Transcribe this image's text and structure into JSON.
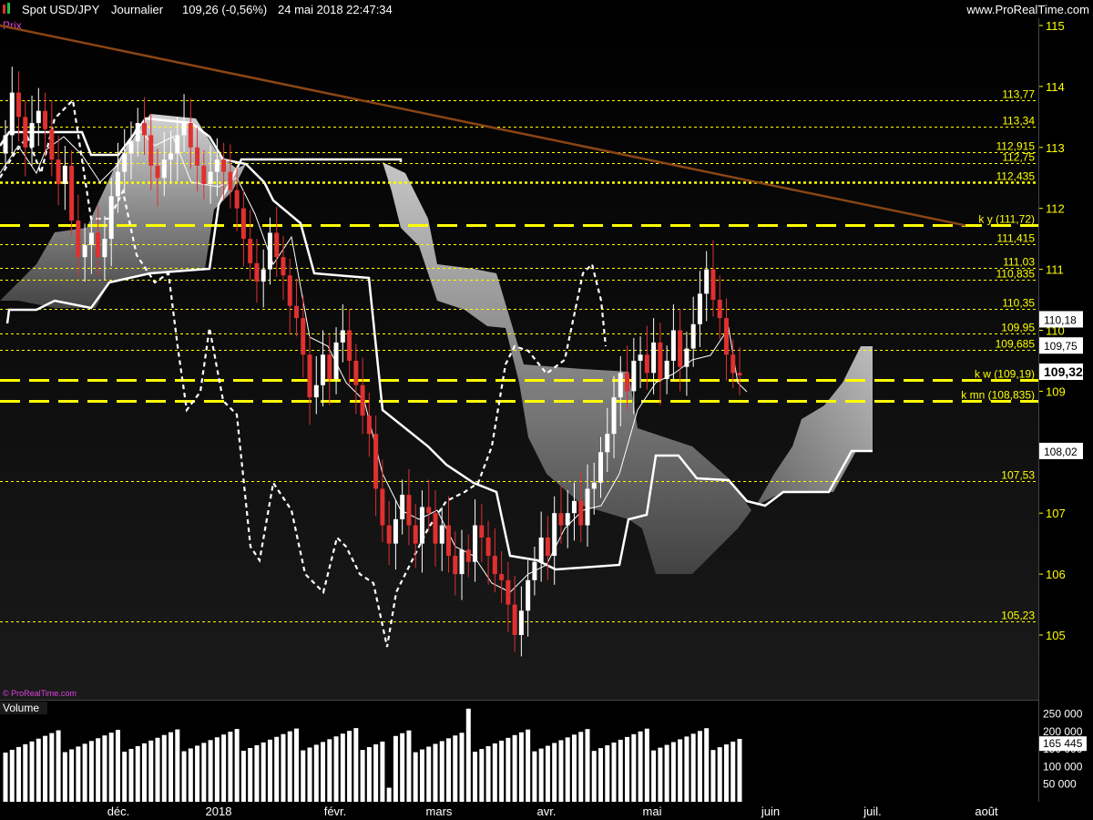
{
  "header": {
    "title": "Spot USD/JPY",
    "period": "Journalier",
    "last": "109,26 (-0,56%)",
    "datetime": "24 mai 2018 22:47:34",
    "site": "www.ProRealTime.com"
  },
  "price_panel_label": "Prix",
  "volume_panel_label": "Volume",
  "watermark": "© ProRealTime.com",
  "colors": {
    "background": "#000000",
    "axis_text": "#ffff00",
    "up_candle": "#ffffff",
    "down_candle": "#e03030",
    "level_line": "#ffff00",
    "trendline": "#8b4513",
    "cloud": "#9a9a9a"
  },
  "chart_data": {
    "type": "candlestick",
    "y_axis": {
      "ticks": [
        105,
        106,
        107,
        108,
        109,
        110,
        111,
        112,
        113,
        114,
        115
      ]
    },
    "x_axis": {
      "ticks": [
        "déc.",
        "2018",
        "févr.",
        "mars",
        "avr.",
        "mai",
        "juin",
        "juil.",
        "août"
      ]
    },
    "price_labels": [
      {
        "label": "110,18",
        "value": 110.18
      },
      {
        "label": "109,75",
        "value": 109.75
      },
      {
        "label": "109,32",
        "value": 109.32
      },
      {
        "label": "108,02",
        "value": 108.02
      }
    ],
    "levels": [
      {
        "label": "113,77",
        "value": 113.77,
        "style": "dotted"
      },
      {
        "label": "113,34",
        "value": 113.34,
        "style": "dotted"
      },
      {
        "label": "112,915",
        "value": 112.915,
        "style": "dotted"
      },
      {
        "label": "112,75",
        "value": 112.75,
        "style": "dotted"
      },
      {
        "label": "112,435",
        "value": 112.435,
        "style": "thick-dotted"
      },
      {
        "label": "k y (111,72)",
        "value": 111.72,
        "style": "dashed"
      },
      {
        "label": "111,415",
        "value": 111.415,
        "style": "dotted"
      },
      {
        "label": "111,03",
        "value": 111.03,
        "style": "dotted"
      },
      {
        "label": "110,835",
        "value": 110.835,
        "style": "dotted"
      },
      {
        "label": "110,35",
        "value": 110.35,
        "style": "dotted"
      },
      {
        "label": "109,95",
        "value": 109.95,
        "style": "dotted"
      },
      {
        "label": "109,685",
        "value": 109.685,
        "style": "dotted"
      },
      {
        "label": "k w (109,19)",
        "value": 109.19,
        "style": "dashed"
      },
      {
        "label": "k mn (108,835)",
        "value": 108.835,
        "style": "dashed"
      },
      {
        "label": "107,53",
        "value": 107.53,
        "style": "dotted"
      },
      {
        "label": "105,23",
        "value": 105.23,
        "style": "dotted"
      }
    ],
    "trendline": [
      [
        115.0,
        0.0
      ],
      [
        111.72,
        1.0
      ]
    ],
    "volume_axis": {
      "ticks": [
        {
          "label": "250 000",
          "value": 250000
        },
        {
          "label": "200 000",
          "value": 200000
        },
        {
          "label": "150 000",
          "value": 150000
        },
        {
          "label": "100 000",
          "value": 100000
        },
        {
          "label": "50 000",
          "value": 50000
        }
      ],
      "current": {
        "label": "165 445",
        "value": 165445
      }
    }
  }
}
